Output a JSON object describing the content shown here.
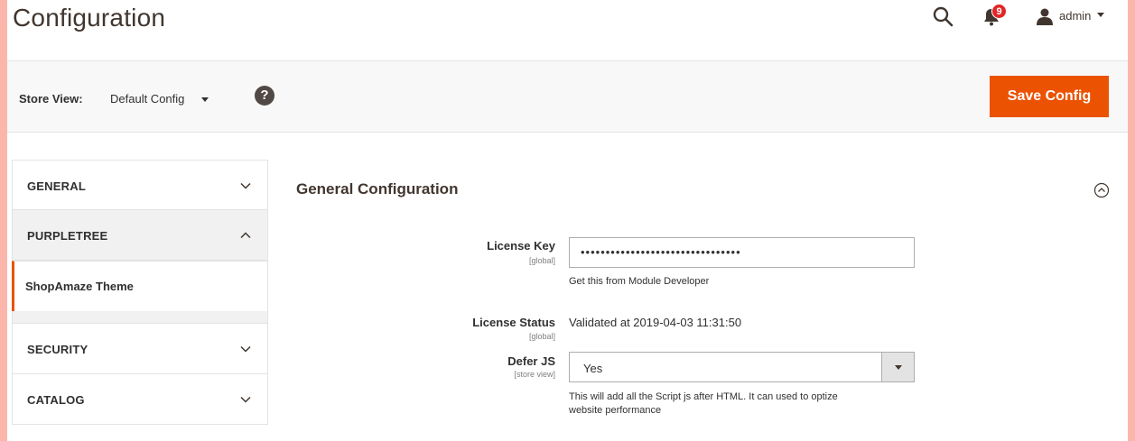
{
  "header": {
    "title": "Configuration",
    "notifications_count": "9",
    "user_name": "admin"
  },
  "scope": {
    "label": "Store View:",
    "selected": "Default Config",
    "help": "?"
  },
  "actions": {
    "save_label": "Save Config"
  },
  "sidebar": {
    "tabs": [
      {
        "label": "GENERAL",
        "expanded": false
      },
      {
        "label": "PURPLETREE",
        "expanded": true,
        "items": [
          {
            "label": "ShopAmaze Theme",
            "active": true
          }
        ]
      },
      {
        "label": "SECURITY",
        "expanded": false
      },
      {
        "label": "CATALOG",
        "expanded": false
      }
    ]
  },
  "section": {
    "title": "General Configuration",
    "fields": {
      "license_key": {
        "label": "License Key",
        "scope": "[global]",
        "value": "••••••••••••••••••••••••••••••••",
        "note": "Get this from Module Developer"
      },
      "license_status": {
        "label": "License Status",
        "scope": "[global]",
        "value": "Validated at 2019-04-03 11:31:50"
      },
      "defer_js": {
        "label": "Defer JS",
        "scope": "[store view]",
        "value": "Yes",
        "note_line1": "This will add all the Script js after HTML. It can used to optize",
        "note_line2": "website performance"
      }
    }
  },
  "colors": {
    "accent": "#eb5202",
    "badge": "#e22626",
    "frame": "#fbb6ab"
  },
  "icons": [
    "search-icon",
    "bell-icon",
    "user-icon",
    "help-icon",
    "chevron-down-icon",
    "chevron-up-icon",
    "collapse-circle-icon"
  ]
}
